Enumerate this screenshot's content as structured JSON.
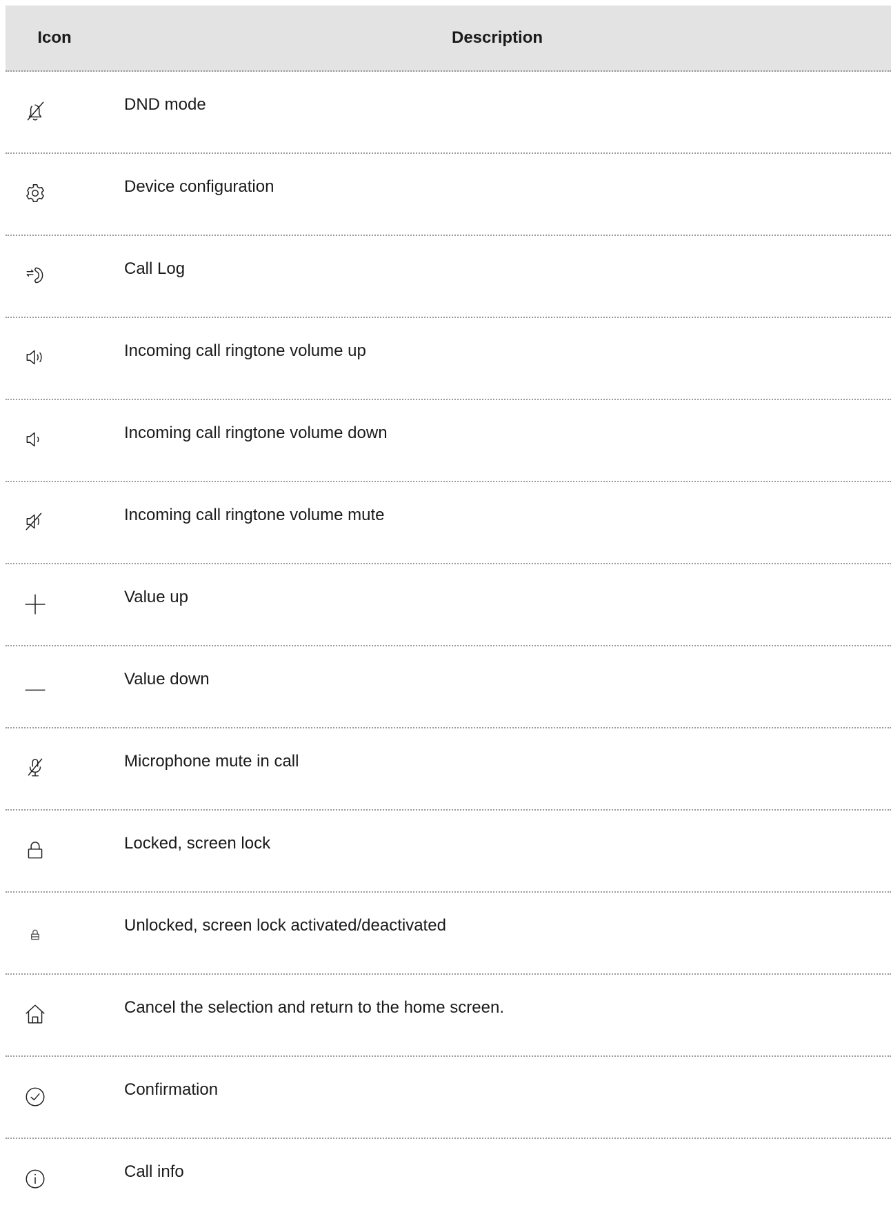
{
  "table": {
    "headers": {
      "icon": "Icon",
      "description": "Description"
    },
    "rows": [
      {
        "icon": "bell-off-icon",
        "description": "DND mode"
      },
      {
        "icon": "gear-icon",
        "description": "Device configuration"
      },
      {
        "icon": "call-log-icon",
        "description": "Call Log"
      },
      {
        "icon": "volume-up-icon",
        "description": "Incoming call ringtone volume up"
      },
      {
        "icon": "volume-down-icon",
        "description": "Incoming call ringtone volume down"
      },
      {
        "icon": "volume-mute-icon",
        "description": "Incoming call ringtone volume mute"
      },
      {
        "icon": "plus-icon",
        "description": "Value up"
      },
      {
        "icon": "minus-icon",
        "description": "Value down"
      },
      {
        "icon": "microphone-mute-icon",
        "description": "Microphone mute in call"
      },
      {
        "icon": "lock-icon",
        "description": "Locked, screen lock"
      },
      {
        "icon": "unlock-small-icon",
        "description": "Unlocked, screen lock activated/deactivated"
      },
      {
        "icon": "home-icon",
        "description": "Cancel the selection and return to the home screen."
      },
      {
        "icon": "check-circle-icon",
        "description": "Confirmation"
      },
      {
        "icon": "info-icon",
        "description": "Call info"
      }
    ]
  }
}
